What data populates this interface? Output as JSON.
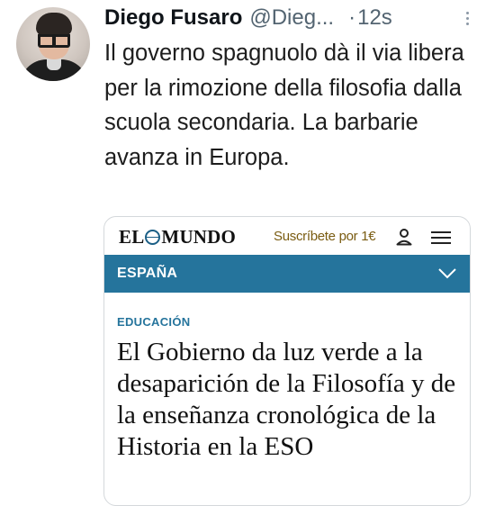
{
  "tweet": {
    "author_name": "Diego Fusaro",
    "author_handle": "@Dieg...",
    "separator": "·",
    "time_ago": "12s",
    "text": "Il governo spagnuolo dà il via libera per la rimozione della filosofia dalla scuola secondaria. La barbarie avanza in Europa."
  },
  "card": {
    "logo_left": "EL",
    "logo_right": "MUNDO",
    "subscribe_label": "Suscríbete por 1€",
    "section_label": "ESPAÑA",
    "kicker": "EDUCACIÓN",
    "headline": "El Gobierno da luz verde a la desaparición de la Filosofía y de la enseñanza cronológica de la Historia en la ESO"
  },
  "colors": {
    "section_bar": "#25749c",
    "subscribe_text": "#7a5c12",
    "secondary_text": "#536471"
  },
  "icons": [
    "more-icon",
    "globe-icon",
    "user-icon",
    "menu-icon",
    "chevron-down-icon"
  ]
}
